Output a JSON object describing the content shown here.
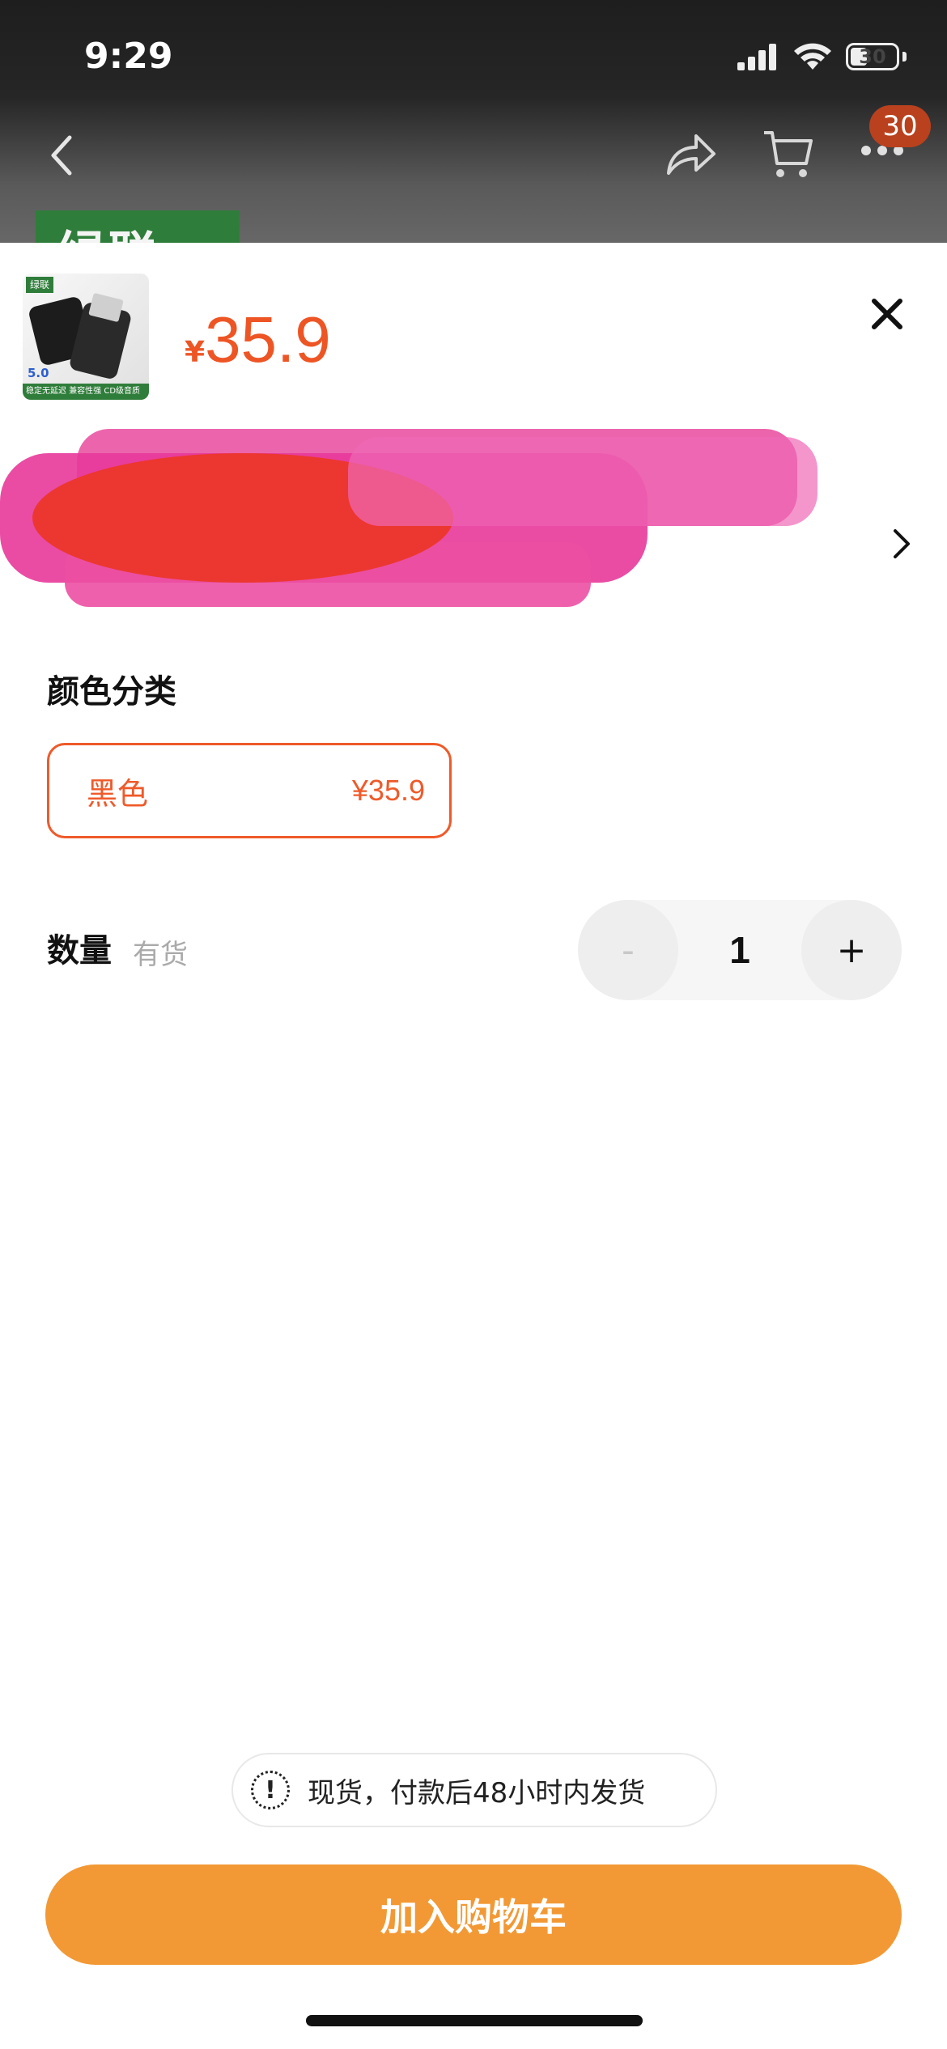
{
  "status_bar": {
    "time": "9:29",
    "battery": "30"
  },
  "nav": {
    "badge_count": "30"
  },
  "background_peek": {
    "text": "绿联"
  },
  "product": {
    "thumbnail": {
      "brand": "绿联",
      "rating": "5.0",
      "tagline": "稳定无延迟 兼容性强 CD级音质"
    },
    "currency": "¥",
    "price": "35.9"
  },
  "variant_section": {
    "title": "颜色分类",
    "options": [
      {
        "name": "黑色",
        "price": "¥35.9",
        "selected": true
      }
    ]
  },
  "quantity": {
    "label": "数量",
    "stock": "有货",
    "value": "1",
    "minus": "-",
    "plus": "+"
  },
  "notice": {
    "icon": "!",
    "text": "现货，付款后48小时内发货"
  },
  "add_to_cart": {
    "label": "加入购物车",
    "color": "#f29935"
  },
  "colors": {
    "accent": "#ef5a2a",
    "button": "#f29935"
  }
}
